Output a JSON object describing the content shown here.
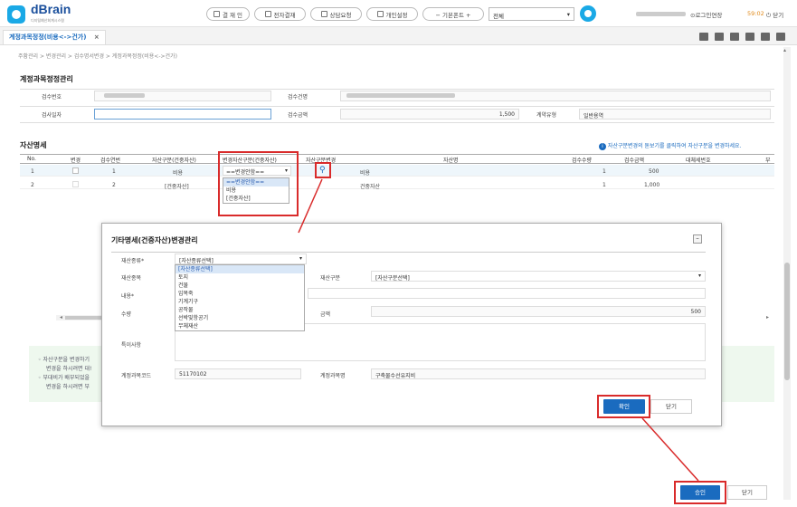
{
  "app": {
    "logo_text": "dBrain",
    "logo_sub": "디지털예산회계시스템"
  },
  "topbar": {
    "buttons": [
      "결 재 인",
      "전자결재",
      "상담요청",
      "개인설정"
    ],
    "basic_fonts": "− 기본폰트 +",
    "select_value": "전체",
    "session_extend": "⊙로그인연장",
    "timer": "59:02",
    "logout": "⏻ 닫기"
  },
  "tab": {
    "label": "계정과목정정(비용<->건가)",
    "close": "×"
  },
  "breadcrumb": "주황관리 > 변경관리 > 검수명서변경 > 계정과목정정(비용<->건가)",
  "page_title": "계정과목정정관리",
  "form": {
    "inspect_no_label": "검수번호",
    "inspect_name_label": "검수건명",
    "inspect_date_label": "검사일자",
    "inspect_amount_label": "검수금액",
    "inspect_amount_value": "1,500",
    "contract_type_label": "계약유형",
    "contract_type_value": "일반용역"
  },
  "asset_section": {
    "title": "자산명세",
    "notice": "자산구분변경의 돋보기를 클릭하여 자산구분을 변경하세요.",
    "headers": [
      "No.",
      "변경",
      "검수연번",
      "자산구분(건중자산)",
      "변경자산구분(건중자산)",
      "자산구분변경",
      "자산명",
      "검수수량",
      "검수금액",
      "대체세번호",
      "부"
    ],
    "rows": [
      {
        "no": "1",
        "seq": "1",
        "asset_type": "비용",
        "change_select": "==변경안함==",
        "asset_name": "비용",
        "qty": "1",
        "amount": "500"
      },
      {
        "no": "2",
        "seq": "2",
        "asset_type": "[건중자산]",
        "change_select": "",
        "asset_name": "건중자산",
        "qty": "1",
        "amount": "1,000"
      }
    ],
    "dropdown_options": [
      "==변경안함==",
      "비용",
      "[건중자산]"
    ]
  },
  "tip": {
    "lines": [
      "◦ 자산구분을 변경하기",
      "변경을 하시려면 대!",
      "◦ 부대비가 배부되었을",
      "변경을 하시려면 부"
    ]
  },
  "modal": {
    "title": "기타명세(건중자산)변경관리",
    "asset_kind_label": "재산종류*",
    "asset_kind_value": "[자산종류선택]",
    "asset_kind_options": [
      "[자산종류선택]",
      "토지",
      "건물",
      "입목죽",
      "기계기구",
      "공작물",
      "선박및항공기",
      "무체재산"
    ],
    "asset_item_label": "재산종목",
    "asset_class_label": "재산구분",
    "asset_class_value": "[자산구분선택]",
    "content_label": "내용*",
    "qty_label": "수량",
    "amount_label": "금액",
    "amount_value": "500",
    "special_label": "특이사항",
    "account_code_label": "계정과목코드",
    "account_code_value": "51170102",
    "account_name_label": "계정과목명",
    "account_name_value": "구축물수선유지비",
    "confirm_label": "확인",
    "close_label": "닫기"
  },
  "footer": {
    "approve_label": "승인",
    "close_label": "닫기"
  },
  "colors": {
    "accent": "#1a6bbf",
    "highlight": "#d92b2b",
    "logo_blue": "#1aa9e6"
  }
}
